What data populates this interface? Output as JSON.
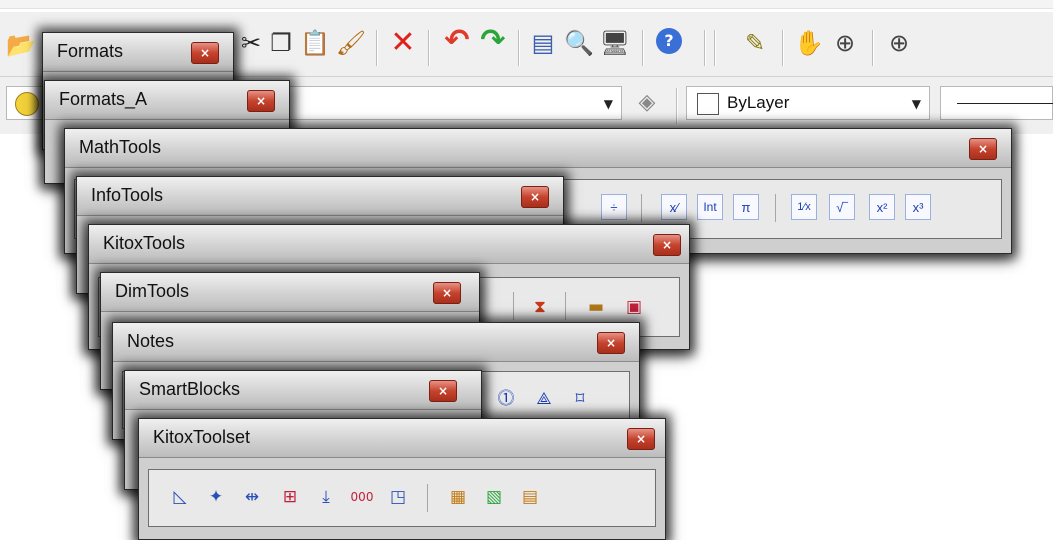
{
  "toolbar": {
    "icons": [
      {
        "name": "open-icon",
        "glyph": "📂"
      },
      {
        "name": "cut-icon",
        "glyph": "✂"
      },
      {
        "name": "copy-icon",
        "glyph": "❐"
      },
      {
        "name": "paste-icon",
        "glyph": "📋"
      },
      {
        "name": "match-properties-icon",
        "glyph": "🖌"
      },
      {
        "name": "erase-icon",
        "glyph": "✕"
      },
      {
        "name": "undo-icon",
        "glyph": "↶"
      },
      {
        "name": "redo-icon",
        "glyph": "↷"
      },
      {
        "name": "properties-icon",
        "glyph": "▤"
      },
      {
        "name": "design-center-icon",
        "glyph": "🔍"
      },
      {
        "name": "tool-palettes-icon",
        "glyph": "🖥"
      },
      {
        "name": "help-icon",
        "glyph": "?"
      },
      {
        "name": "pencil-icon",
        "glyph": "✎"
      },
      {
        "name": "pan-icon",
        "glyph": "✋"
      },
      {
        "name": "zoom-realtime-icon",
        "glyph": "⊕"
      },
      {
        "name": "zoom-window-icon",
        "glyph": "⊕"
      }
    ],
    "color_combo": {
      "value": "ByLayer"
    }
  },
  "palettes": {
    "formats": {
      "title": "Formats"
    },
    "formats_a": {
      "title": "Formats_A"
    },
    "mathtools": {
      "title": "MathTools",
      "buttons": [
        "÷",
        "x⁄",
        "Int",
        "π",
        "1⁄x",
        "√‾",
        "x²",
        "x³"
      ]
    },
    "infotools": {
      "title": "InfoTools"
    },
    "kitoxtools": {
      "title": "KitoxTools"
    },
    "dimtools": {
      "title": "DimTools"
    },
    "notes": {
      "title": "Notes"
    },
    "smartblocks": {
      "title": "SmartBlocks"
    },
    "kitoxtoolset": {
      "title": "KitoxToolset"
    }
  },
  "close_glyph": "×",
  "colors": {
    "close_button": "#c5432e",
    "math_icon_blue": "#1b3fb3",
    "undo_red": "#e03a2a",
    "redo_green": "#2aa53a"
  }
}
